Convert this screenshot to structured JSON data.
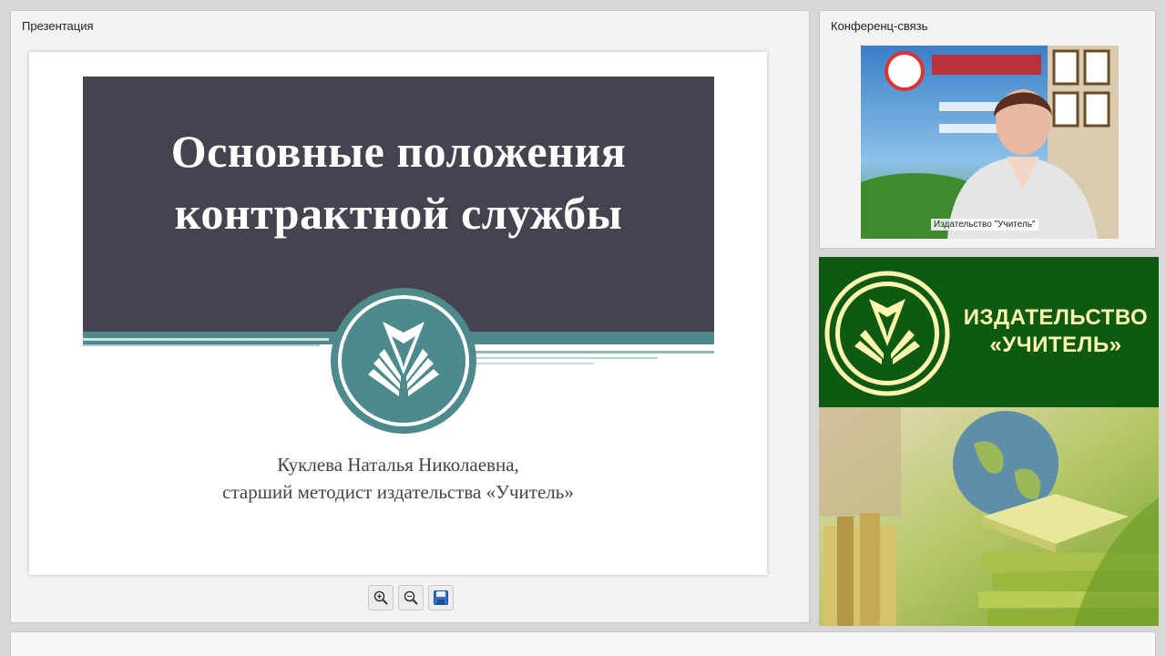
{
  "presentation": {
    "title": "Презентация",
    "slide": {
      "heading_line1": "Основные положения",
      "heading_line2": "контрактной службы",
      "author_line1": "Куклева Наталья Николаевна,",
      "author_line2": "старший методист издательства «Учитель»"
    },
    "toolbar": {
      "zoom_in_icon": "zoom-in-icon",
      "zoom_out_icon": "zoom-out-icon",
      "save_icon": "save-icon"
    }
  },
  "conference": {
    "title": "Конференц-связь",
    "participant_label": "Издательство \"Учитель\""
  },
  "banner": {
    "name_line1": "ИЗДАТЕЛЬСТВО",
    "name_line2": "«УЧИТЕЛЬ»"
  },
  "colors": {
    "slide_header": "#44434f",
    "teal": "#4e8a8c",
    "banner_green": "#0f5a12",
    "banner_text": "#fff6b0"
  }
}
